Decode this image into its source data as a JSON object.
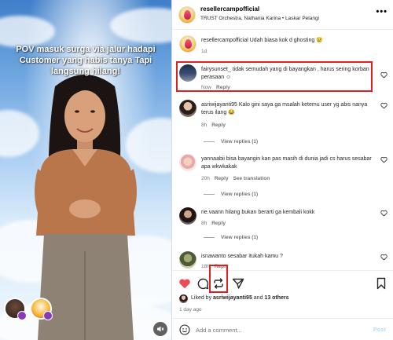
{
  "video": {
    "caption": "POV masuk surga via jalur hadapi Customer yang habis tanya Tapi langsung hilang!"
  },
  "post": {
    "username": "resellercampofficial",
    "subtitle": "TRUST Orchestra, Nathania Karina • Laskar Pelangi",
    "more_icon": "more-horizontal-icon"
  },
  "caption_comment": {
    "username": "resellercampofficial",
    "text": " Udah biasa kok d ghosting 😢",
    "time": "1d"
  },
  "comments": [
    {
      "username": "fairysunset_",
      "text": " tidak semudah yang di bayangkan , harus sering korban perasaan ☺",
      "time": "Now",
      "reply": "Reply",
      "highlighted": true
    },
    {
      "username": "asriwijayanti95",
      "text": " Kalo gini saya ga msalah ketemu user yg abis nanya terus ilang 😂",
      "time": "8h",
      "reply": "Reply",
      "view_replies": "View replies (1)"
    },
    {
      "username": "yannaabii",
      "text": " bisa bayangin kan pas masih di dunia jadi cs harus sesabar apa wkwkakak",
      "time": "20h",
      "reply": "Reply",
      "see_translation": "See translation",
      "view_replies": "View replies (1)"
    },
    {
      "username": "rie.vaann",
      "text": " hilang bukan berarti ga kembali kokk",
      "time": "8h",
      "reply": "Reply",
      "view_replies": "View replies (1)"
    },
    {
      "username": "isnawanto",
      "text": " sesabar itukah kamu ?",
      "time": "18h",
      "reply": "Reply"
    }
  ],
  "likes": {
    "prefix": "Liked by ",
    "user": "asriwijayanti95",
    "middle": " and ",
    "others": "13 others"
  },
  "date": "1 day ago",
  "composer": {
    "placeholder": "Add a comment...",
    "post_label": "Post"
  },
  "colors": {
    "like_red": "#ed4956",
    "highlight_red": "#e02020",
    "post_blue": "#b2dffc",
    "secondary_text": "#737373"
  }
}
